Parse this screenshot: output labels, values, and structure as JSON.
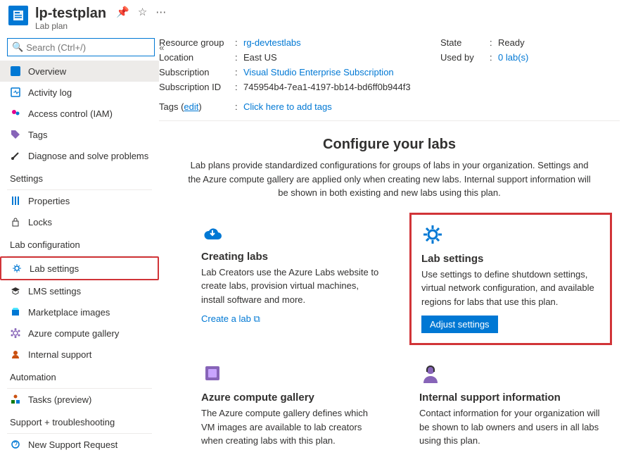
{
  "header": {
    "title": "lp-testplan",
    "subtitle": "Lab plan"
  },
  "search": {
    "placeholder": "Search (Ctrl+/)"
  },
  "nav": {
    "overview": "Overview",
    "activity": "Activity log",
    "iam": "Access control (IAM)",
    "tags": "Tags",
    "diagnose": "Diagnose and solve problems",
    "section_settings": "Settings",
    "properties": "Properties",
    "locks": "Locks",
    "section_labconfig": "Lab configuration",
    "labsettings": "Lab settings",
    "lms": "LMS settings",
    "marketplace": "Marketplace images",
    "gallery": "Azure compute gallery",
    "support": "Internal support",
    "section_automation": "Automation",
    "tasks": "Tasks (preview)",
    "section_support": "Support + troubleshooting",
    "newsupport": "New Support Request"
  },
  "essentials": {
    "rg_label": "Resource group",
    "rg_value": "rg-devtestlabs",
    "loc_label": "Location",
    "loc_value": "East US",
    "sub_label": "Subscription",
    "sub_value": "Visual Studio Enterprise Subscription",
    "subid_label": "Subscription ID",
    "subid_value": "745954b4-7ea1-4197-bb14-bd6ff0b944f3",
    "state_label": "State",
    "state_value": "Ready",
    "usedby_label": "Used by",
    "usedby_value": "0 lab(s)",
    "tags_label": "Tags",
    "tags_edit": "edit",
    "tags_value": "Click here to add tags"
  },
  "center": {
    "title": "Configure your labs",
    "desc": "Lab plans provide standardized configurations for groups of labs in your organization. Settings and the Azure compute gallery are applied only when creating new labs. Internal support information will be shown in both existing and new labs using this plan."
  },
  "cards": {
    "creating": {
      "title": "Creating labs",
      "desc": "Lab Creators use the Azure Labs website to create labs, provision virtual machines, install software and more.",
      "link": "Create a lab"
    },
    "labsettings": {
      "title": "Lab settings",
      "desc": "Use settings to define shutdown settings, virtual network configuration, and available regions for labs that use this plan.",
      "button": "Adjust settings"
    },
    "gallery": {
      "title": "Azure compute gallery",
      "desc": "The Azure compute gallery defines which VM images are available to lab creators when creating labs with this plan."
    },
    "support": {
      "title": "Internal support information",
      "desc": "Contact information for your organization will be shown to lab owners and users in all labs using this plan."
    }
  }
}
